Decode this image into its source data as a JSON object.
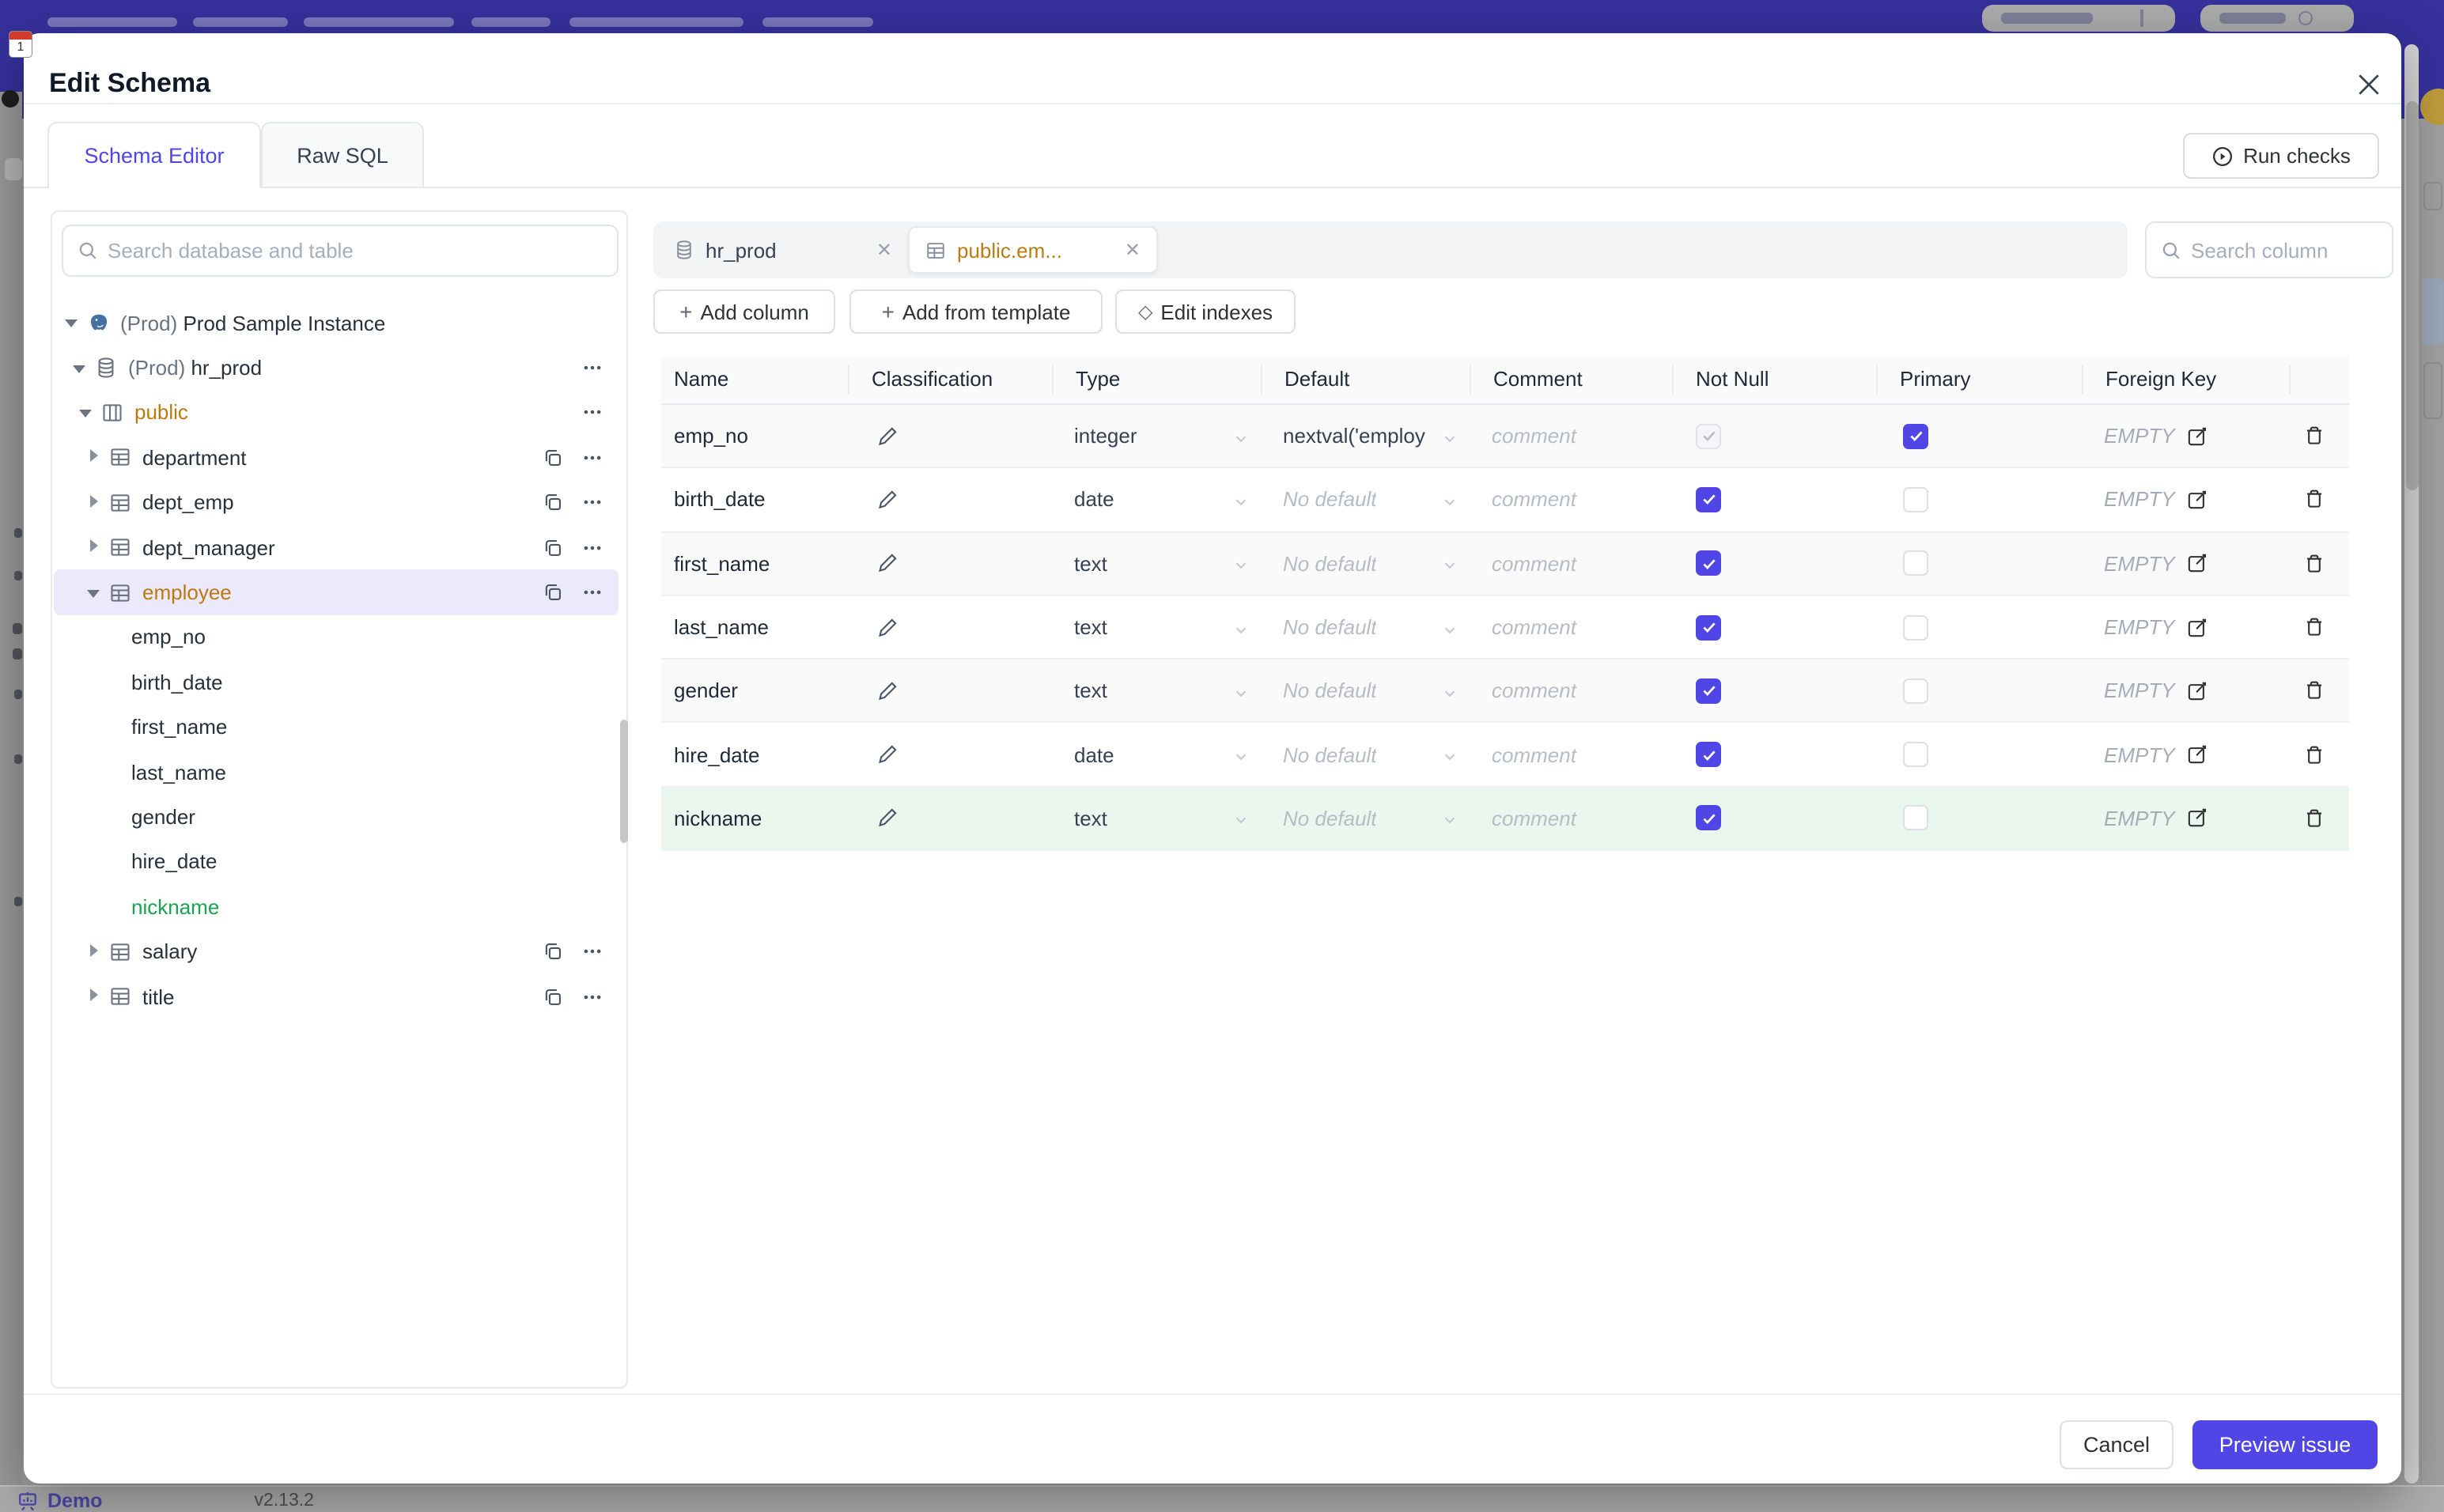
{
  "modal": {
    "title": "Edit Schema",
    "tabs": [
      {
        "label": "Schema Editor",
        "active": true
      },
      {
        "label": "Raw SQL",
        "active": false
      }
    ],
    "run_checks_label": "Run checks"
  },
  "sidebar": {
    "search_placeholder": "Search database and table",
    "tree": [
      {
        "env": "(Prod) ",
        "label": "Prod Sample Instance",
        "type": "instance",
        "caret": "down",
        "color": "default"
      },
      {
        "env": "(Prod) ",
        "label": "hr_prod",
        "type": "database",
        "caret": "down",
        "color": "default",
        "more": true
      },
      {
        "env": "",
        "label": "public",
        "type": "schema",
        "caret": "down",
        "color": "amber",
        "more": true
      },
      {
        "env": "",
        "label": "department",
        "type": "table",
        "caret": "right",
        "color": "default",
        "copy": true,
        "more": true
      },
      {
        "env": "",
        "label": "dept_emp",
        "type": "table",
        "caret": "right",
        "color": "default",
        "copy": true,
        "more": true
      },
      {
        "env": "",
        "label": "dept_manager",
        "type": "table",
        "caret": "right",
        "color": "default",
        "copy": true,
        "more": true
      },
      {
        "env": "",
        "label": "employee",
        "type": "table",
        "caret": "down",
        "color": "amber",
        "selected": true,
        "copy": true,
        "more": true
      },
      {
        "env": "",
        "label": "emp_no",
        "type": "column",
        "color": "default"
      },
      {
        "env": "",
        "label": "birth_date",
        "type": "column",
        "color": "default"
      },
      {
        "env": "",
        "label": "first_name",
        "type": "column",
        "color": "default"
      },
      {
        "env": "",
        "label": "last_name",
        "type": "column",
        "color": "default"
      },
      {
        "env": "",
        "label": "gender",
        "type": "column",
        "color": "default"
      },
      {
        "env": "",
        "label": "hire_date",
        "type": "column",
        "color": "default"
      },
      {
        "env": "",
        "label": "nickname",
        "type": "column",
        "color": "green"
      },
      {
        "env": "",
        "label": "salary",
        "type": "table",
        "caret": "right",
        "color": "default",
        "copy": true,
        "more": true
      },
      {
        "env": "",
        "label": "title",
        "type": "table",
        "caret": "right",
        "color": "default",
        "copy": true,
        "more": true
      }
    ]
  },
  "editor": {
    "tabs": [
      {
        "label": "hr_prod",
        "icon": "database",
        "active": false
      },
      {
        "label": "public.em...",
        "icon": "table",
        "active": true
      }
    ],
    "toolbar": {
      "add_column": "Add column",
      "add_from_template": "Add from template",
      "edit_indexes": "Edit indexes"
    },
    "search_placeholder": "Search column",
    "table": {
      "headers": [
        "Name",
        "Classification",
        "Type",
        "Default",
        "Comment",
        "Not Null",
        "Primary",
        "Foreign Key"
      ],
      "comment_placeholder": "comment",
      "fk_placeholder": "EMPTY",
      "rows": [
        {
          "name": "emp_no",
          "type": "integer",
          "default": "nextval('employ",
          "default_placeholder": false,
          "not_null": "checked-disabled",
          "primary": "checked",
          "variant": "normal"
        },
        {
          "name": "birth_date",
          "type": "date",
          "default": "No default",
          "default_placeholder": true,
          "not_null": "checked",
          "primary": "unchecked",
          "variant": "normal"
        },
        {
          "name": "first_name",
          "type": "text",
          "default": "No default",
          "default_placeholder": true,
          "not_null": "checked",
          "primary": "unchecked",
          "variant": "normal"
        },
        {
          "name": "last_name",
          "type": "text",
          "default": "No default",
          "default_placeholder": true,
          "not_null": "checked",
          "primary": "unchecked",
          "variant": "normal"
        },
        {
          "name": "gender",
          "type": "text",
          "default": "No default",
          "default_placeholder": true,
          "not_null": "checked",
          "primary": "unchecked",
          "variant": "normal"
        },
        {
          "name": "hire_date",
          "type": "date",
          "default": "No default",
          "default_placeholder": true,
          "not_null": "checked",
          "primary": "unchecked",
          "variant": "normal"
        },
        {
          "name": "nickname",
          "type": "text",
          "default": "No default",
          "default_placeholder": true,
          "not_null": "checked",
          "primary": "unchecked",
          "variant": "new"
        }
      ]
    },
    "footer": {
      "cancel": "Cancel",
      "submit": "Preview issue"
    }
  },
  "statusbar": {
    "brand": "Demo",
    "version": "v2.13.2"
  },
  "colors": {
    "accent": "#4f46e5",
    "amber": "#bd7a11",
    "green": "#18a550",
    "topbar": "#36319c",
    "new_row_bg": "#eaf7ef"
  }
}
